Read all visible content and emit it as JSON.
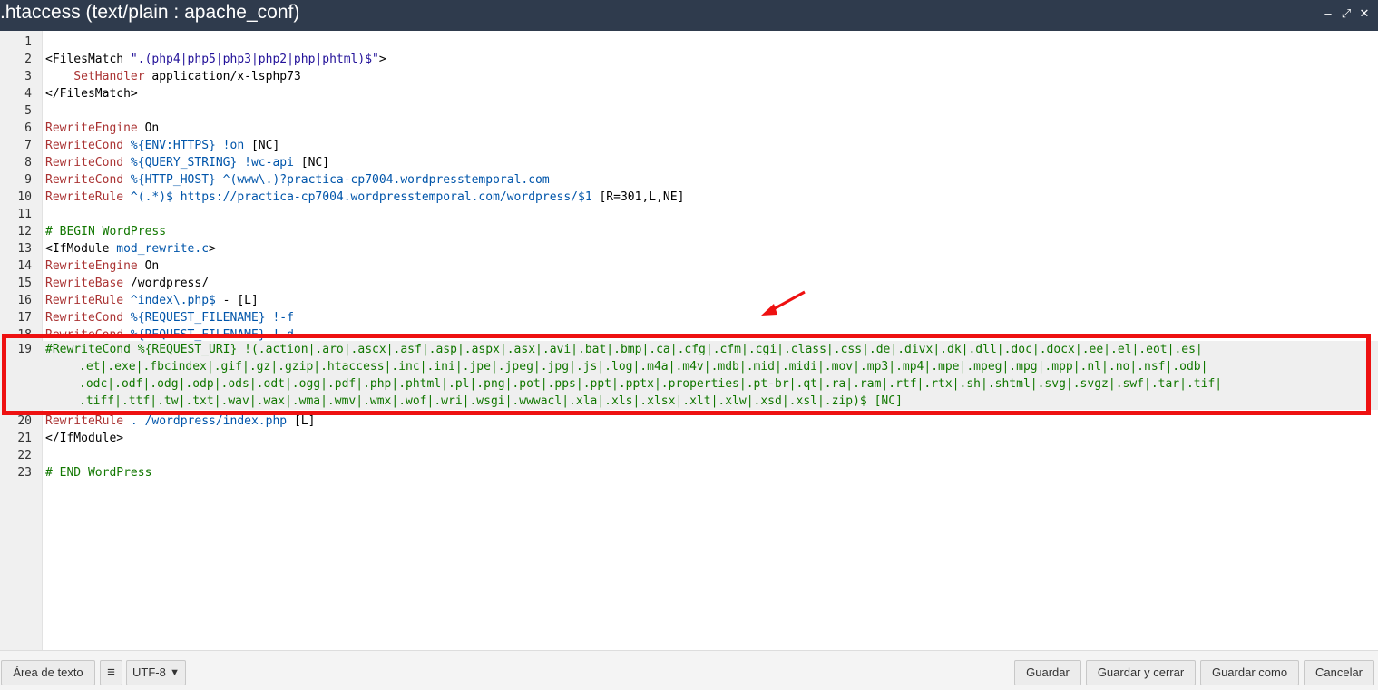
{
  "window": {
    "title": ".htaccess (text/plain : apache_conf)",
    "minimize_glyph": "‒",
    "restore_glyph": "⤢",
    "close_glyph": "✕"
  },
  "editor": {
    "lines": [
      {
        "n": "1",
        "parts": []
      },
      {
        "n": "2",
        "parts": [
          {
            "t": "<FilesMatch ",
            "c": "plain"
          },
          {
            "t": "\".(php4|php5|php3|php2|php|phtml)$\"",
            "c": "atom"
          },
          {
            "t": ">",
            "c": "plain"
          }
        ]
      },
      {
        "n": "3",
        "parts": [
          {
            "t": "    SetHandler ",
            "c": "dir"
          },
          {
            "t": "application/x-lsphp73",
            "c": "plain"
          }
        ]
      },
      {
        "n": "4",
        "parts": [
          {
            "t": "</FilesMatch>",
            "c": "plain"
          }
        ]
      },
      {
        "n": "5",
        "parts": []
      },
      {
        "n": "6",
        "parts": [
          {
            "t": "RewriteEngine ",
            "c": "dir"
          },
          {
            "t": "On",
            "c": "plain"
          }
        ]
      },
      {
        "n": "7",
        "parts": [
          {
            "t": "RewriteCond ",
            "c": "dir"
          },
          {
            "t": "%{ENV:HTTPS}",
            "c": "var"
          },
          {
            "t": " !on ",
            "c": "var"
          },
          {
            "t": "[NC]",
            "c": "plain"
          }
        ]
      },
      {
        "n": "8",
        "parts": [
          {
            "t": "RewriteCond ",
            "c": "dir"
          },
          {
            "t": "%{QUERY_STRING}",
            "c": "var"
          },
          {
            "t": " !wc-api ",
            "c": "var"
          },
          {
            "t": "[NC]",
            "c": "plain"
          }
        ]
      },
      {
        "n": "9",
        "parts": [
          {
            "t": "RewriteCond ",
            "c": "dir"
          },
          {
            "t": "%{HTTP_HOST}",
            "c": "var"
          },
          {
            "t": " ^(www\\.)?practica-cp7004.wordpresstemporal.com",
            "c": "var"
          }
        ]
      },
      {
        "n": "10",
        "parts": [
          {
            "t": "RewriteRule ",
            "c": "dir"
          },
          {
            "t": "^(.*)$ https://practica-cp7004.wordpresstemporal.com/wordpress/$1 ",
            "c": "var"
          },
          {
            "t": "[R=301,L,NE]",
            "c": "plain"
          }
        ]
      },
      {
        "n": "11",
        "parts": []
      },
      {
        "n": "12",
        "parts": [
          {
            "t": "# BEGIN WordPress",
            "c": "tag"
          }
        ]
      },
      {
        "n": "13",
        "parts": [
          {
            "t": "<IfModule ",
            "c": "plain"
          },
          {
            "t": "mod_rewrite.c",
            "c": "var"
          },
          {
            "t": ">",
            "c": "plain"
          }
        ]
      },
      {
        "n": "14",
        "parts": [
          {
            "t": "RewriteEngine ",
            "c": "dir"
          },
          {
            "t": "On",
            "c": "plain"
          }
        ]
      },
      {
        "n": "15",
        "parts": [
          {
            "t": "RewriteBase ",
            "c": "dir"
          },
          {
            "t": "/wordpress/",
            "c": "plain"
          }
        ]
      },
      {
        "n": "16",
        "parts": [
          {
            "t": "RewriteRule ",
            "c": "dir"
          },
          {
            "t": "^index\\.php$",
            "c": "var"
          },
          {
            "t": " - [L]",
            "c": "plain"
          }
        ]
      },
      {
        "n": "17",
        "parts": [
          {
            "t": "RewriteCond ",
            "c": "dir"
          },
          {
            "t": "%{REQUEST_FILENAME}",
            "c": "var"
          },
          {
            "t": " !-f",
            "c": "var"
          }
        ]
      },
      {
        "n": "18",
        "parts": [
          {
            "t": "RewriteCond ",
            "c": "dir"
          },
          {
            "t": "%{REQUEST_FILENAME}",
            "c": "var"
          },
          {
            "t": " !-d",
            "c": "var"
          }
        ]
      }
    ],
    "line19": {
      "n": "19",
      "segments": [
        "#RewriteCond %{REQUEST_URI} !(.action|.aro|.ascx|.asf|.asp|.aspx|.asx|.avi|.bat|.bmp|.ca|.cfg|.cfm|.cgi|.class|.css|.de|.divx|.dk|.dll|.doc|.docx|.ee|.el|.eot|.es|",
        ".et|.exe|.fbcindex|.gif|.gz|.gzip|.htaccess|.inc|.ini|.jpe|.jpeg|.jpg|.js|.log|.m4a|.m4v|.mdb|.mid|.midi|.mov|.mp3|.mp4|.mpe|.mpeg|.mpg|.mpp|.nl|.no|.nsf|.odb|",
        ".odc|.odf|.odg|.odp|.ods|.odt|.ogg|.pdf|.php|.phtml|.pl|.png|.pot|.pps|.ppt|.pptx|.properties|.pt-br|.qt|.ra|.ram|.rtf|.rtx|.sh|.shtml|.svg|.svgz|.swf|.tar|.tif|",
        ".tiff|.ttf|.tw|.txt|.wav|.wax|.wma|.wmv|.wmx|.wof|.wri|.wsgi|.wwwacl|.xla|.xls|.xlsx|.xlt|.xlw|.xsd|.xsl|.zip)$ [NC]"
      ]
    },
    "lines_after": [
      {
        "n": "20",
        "parts": [
          {
            "t": "RewriteRule ",
            "c": "dir"
          },
          {
            "t": ". /wordpress/index.php ",
            "c": "var"
          },
          {
            "t": "[L]",
            "c": "plain"
          }
        ]
      },
      {
        "n": "21",
        "parts": [
          {
            "t": "</IfModule>",
            "c": "plain"
          }
        ]
      },
      {
        "n": "22",
        "parts": []
      },
      {
        "n": "23",
        "parts": [
          {
            "t": "# END WordPress",
            "c": "tag"
          }
        ]
      }
    ]
  },
  "toolbar": {
    "textarea_label": "Área de texto",
    "settings_icon": "≡",
    "encoding": "UTF-8",
    "save_label": "Guardar",
    "save_close_label": "Guardar y cerrar",
    "save_as_label": "Guardar como",
    "cancel_label": "Cancelar"
  },
  "colors": {
    "titlebar": "#2f3b4d",
    "highlight": "#ee1111"
  }
}
